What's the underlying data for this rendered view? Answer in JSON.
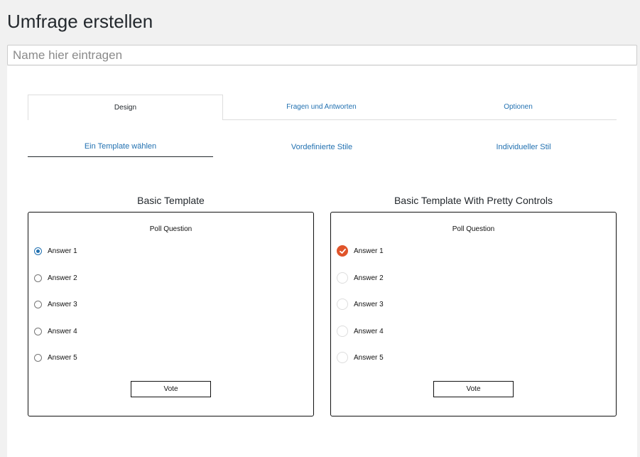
{
  "page": {
    "title": "Umfrage erstellen"
  },
  "name_input": {
    "placeholder": "Name hier eintragen",
    "value": ""
  },
  "tabs": [
    {
      "label": "Design",
      "active": true
    },
    {
      "label": "Fragen und Antworten",
      "active": false
    },
    {
      "label": "Optionen",
      "active": false
    }
  ],
  "subtabs": [
    {
      "label": "Ein Template wählen",
      "active": true
    },
    {
      "label": "Vordefinierte Stile",
      "active": false
    },
    {
      "label": "Individueller Stil",
      "active": false
    }
  ],
  "templates": {
    "basic": {
      "title": "Basic Template",
      "question": "Poll Question",
      "answers": [
        "Answer 1",
        "Answer 2",
        "Answer 3",
        "Answer 4",
        "Answer 5"
      ],
      "selected_index": 0,
      "vote_label": "Vote"
    },
    "pretty": {
      "title": "Basic Template With Pretty Controls",
      "question": "Poll Question",
      "answers": [
        "Answer 1",
        "Answer 2",
        "Answer 3",
        "Answer 4",
        "Answer 5"
      ],
      "selected_index": 0,
      "vote_label": "Vote"
    }
  },
  "colors": {
    "accent": "#2271b1",
    "pretty_check": "#e0542a"
  }
}
